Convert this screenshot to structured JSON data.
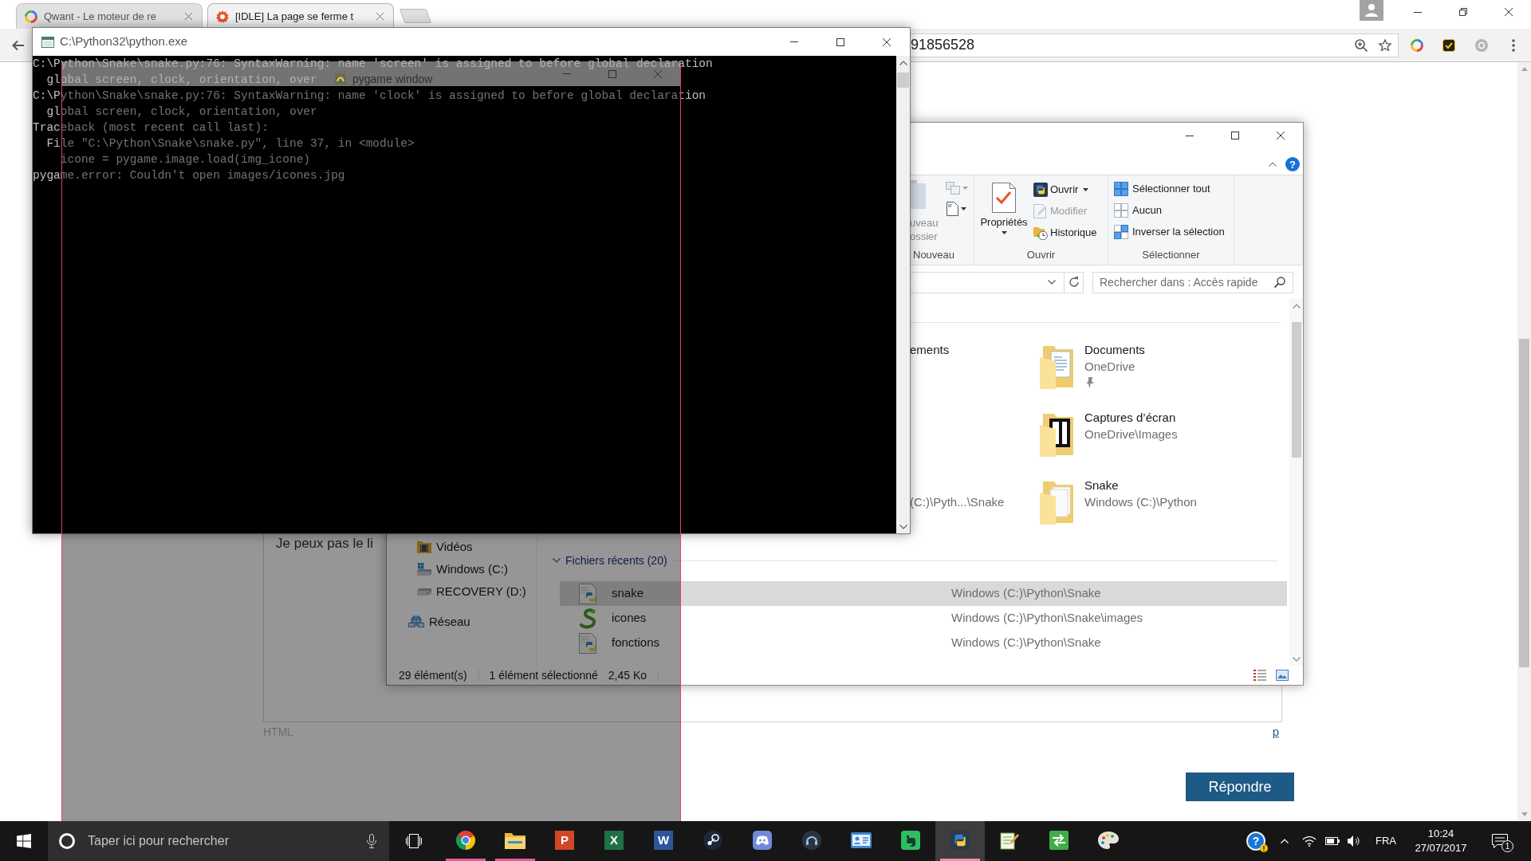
{
  "browser": {
    "tabs": [
      {
        "title": "Qwant - Le moteur de re",
        "kind": "ring",
        "selected": false
      },
      {
        "title": "[IDLE] La page se ferme t",
        "kind": "burst",
        "selected": true
      }
    ],
    "address": "91856528",
    "page": {
      "reply_text": "Je peux pas le li",
      "format_label": "HTML",
      "link": "p",
      "reply_button": "Répondre"
    }
  },
  "explorer": {
    "ribbon": {
      "help": "?",
      "new_group": {
        "label": "Nouveau",
        "new_folder": {
          "lines": [
            "uveau",
            "ossier"
          ],
          "disabled": true
        }
      },
      "open_group": {
        "label": "Ouvrir",
        "properties": "Propriétés",
        "items": [
          {
            "label": "Ouvrir",
            "kind": "open",
            "dropdown": true,
            "disabled": false
          },
          {
            "label": "Modifier",
            "kind": "edit",
            "dropdown": false,
            "disabled": true
          },
          {
            "label": "Historique",
            "kind": "history",
            "dropdown": false,
            "disabled": false
          }
        ]
      },
      "select_group": {
        "label": "Sélectionner",
        "items": [
          {
            "label": "Sélectionner tout",
            "kind": "all"
          },
          {
            "label": "Aucun",
            "kind": "none"
          },
          {
            "label": "Inverser la sélection",
            "kind": "invert"
          }
        ]
      }
    },
    "search": {
      "placeholder": "Rechercher dans : Accès rapide"
    },
    "nav_pane": [
      {
        "kind": "group",
        "children": [
          {
            "label": "Vidéos",
            "kind": "videos"
          },
          {
            "label": "Windows (C:)",
            "kind": "system_drive"
          },
          {
            "label": "RECOVERY (D:)",
            "kind": "drive"
          }
        ]
      },
      {
        "label": "Réseau",
        "kind": "network"
      }
    ],
    "frequent_folder_rows": [
      {
        "cut_item": {
          "name": "ements"
        },
        "folder": {
          "name": "Documents",
          "location": "OneDrive",
          "kind": "documents",
          "pinned": true
        }
      },
      {
        "folder": {
          "name": "Captures d’écran",
          "location": "OneDrive\\Images",
          "kind": "pictures",
          "pinned": false
        }
      },
      {
        "cut_item": {
          "location": "(C:)\\Pyth...\\Snake"
        },
        "folder": {
          "name": "Snake",
          "location": "Windows (C:)\\Python",
          "kind": "plain",
          "pinned": false
        }
      }
    ],
    "recent_files": {
      "title": "Fichiers récents (20)",
      "expanded": true,
      "rows": [
        {
          "name": "snake",
          "location": "Windows (C:)\\Python\\Snake",
          "kind": "python",
          "selected": true
        },
        {
          "name": "icones",
          "location": "Windows (C:)\\Python\\Snake\\images",
          "kind": "image",
          "selected": false
        },
        {
          "name": "fonctions",
          "location": "Windows (C:)\\Python\\Snake",
          "kind": "python",
          "selected": false
        }
      ]
    },
    "status_bar": [
      "29 élément(s)",
      "1 élément sélectionné",
      "2,45 Ko"
    ]
  },
  "console": {
    "title": "C:\\Python32\\python.exe",
    "lines": [
      "C:\\Python\\Snake\\snake.py:76: SyntaxWarning: name 'screen' is assigned to before global declaration",
      "  global screen, clock, orientation, over",
      "C:\\Python\\Snake\\snake.py:76: SyntaxWarning: name 'clock' is assigned to before global declaration",
      "  global screen, clock, orientation, over",
      "Traceback (most recent call last):",
      "  File \"C:\\Python\\Snake\\snake.py\", line 37, in <module>",
      "    icone = pygame.image.load(img_icone)",
      "pygame.error: Couldn't open images/icones.jpg"
    ]
  },
  "pygame_window": {
    "title": "pygame window"
  },
  "taskbar": {
    "search": {
      "placeholder": "Taper ici pour rechercher"
    },
    "apps": [
      {
        "kind": "browser",
        "running": true,
        "active": false
      },
      {
        "kind": "folder",
        "running": true,
        "active": false
      },
      {
        "kind": "slides",
        "letter": "P",
        "running": false,
        "active": false
      },
      {
        "kind": "sheet",
        "letter": "X",
        "running": false,
        "active": false
      },
      {
        "kind": "doc",
        "letter": "W",
        "running": false,
        "active": false
      },
      {
        "kind": "steam",
        "running": false,
        "active": false
      },
      {
        "kind": "chat",
        "running": false,
        "active": false
      },
      {
        "kind": "headset",
        "running": false,
        "active": false
      },
      {
        "kind": "card",
        "running": false,
        "active": false
      },
      {
        "kind": "note",
        "running": false,
        "active": false
      },
      {
        "kind": "python",
        "running": true,
        "active": true
      },
      {
        "kind": "notepad",
        "running": false,
        "active": false
      },
      {
        "kind": "remote",
        "running": false,
        "active": false
      },
      {
        "kind": "paint",
        "running": false,
        "active": false
      }
    ],
    "tray": {
      "help": "?",
      "language": "FRA",
      "time": "10:24",
      "date": "27/07/2017",
      "notifications": "1"
    }
  }
}
